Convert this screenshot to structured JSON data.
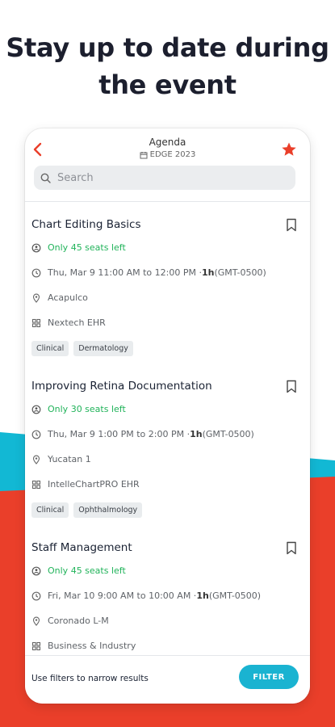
{
  "headline": {
    "line1": "Stay up to date during",
    "line2": "the event"
  },
  "colors": {
    "teal": "#12b8d4",
    "red": "#ea3f2a",
    "green": "#21b35a",
    "accent_button": "#1ab3d1"
  },
  "header": {
    "title": "Agenda",
    "event": "EDGE 2023",
    "back_icon": "chevron-left-icon",
    "favorite_icon": "star-icon"
  },
  "search": {
    "placeholder": "Search"
  },
  "sessions": [
    {
      "title": "Chart Editing Basics",
      "seats": "Only 45 seats left",
      "time": "Thu, Mar 9 11:00 AM to 12:00 PM · ",
      "duration": "1h",
      "tz": " (GMT-0500)",
      "location": "Acapulco",
      "sponsor": "Nextech EHR",
      "tags": [
        "Clinical",
        "Dermatology"
      ]
    },
    {
      "title": "Improving Retina Documentation",
      "seats": "Only 30 seats left",
      "time": "Thu, Mar 9 1:00 PM to 2:00 PM · ",
      "duration": "1h",
      "tz": " (GMT-0500)",
      "location": "Yucatan 1",
      "sponsor": "IntelleChartPRO EHR",
      "tags": [
        "Clinical",
        "Ophthalmology"
      ]
    },
    {
      "title": "Staff Management",
      "seats": "Only 45 seats left",
      "time": "Fri, Mar 10 9:00 AM to 10:00 AM · ",
      "duration": "1h",
      "tz": " (GMT-0500)",
      "location": "Coronado L-M",
      "sponsor": "Business & Industry",
      "tags": []
    }
  ],
  "footer": {
    "hint": "Use filters to narrow results",
    "filter_label": "FILTER"
  }
}
